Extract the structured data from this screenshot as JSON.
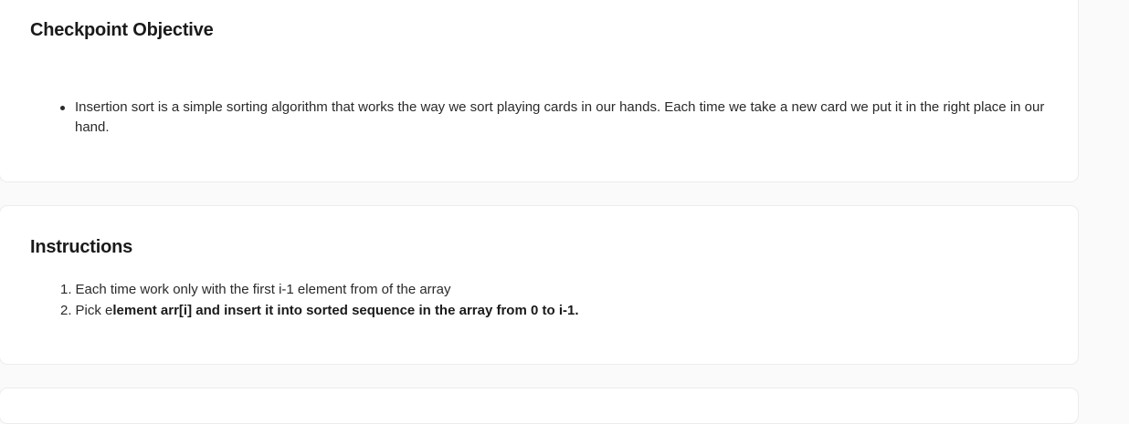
{
  "objective": {
    "title": "Checkpoint Objective",
    "bullets": [
      "Insertion sort is a simple sorting algorithm that works the way we sort playing cards in our hands. Each time we take a new card we put it in the right place in our hand."
    ]
  },
  "instructions": {
    "title": "Instructions",
    "steps": [
      {
        "number": "1.",
        "text": "Each time work only with the first i-1 element from of the array",
        "bold": ""
      },
      {
        "number": "2.",
        "text": "Pick e",
        "bold": "lement arr[i] and insert it into sorted sequence in the array from 0 to i-1."
      }
    ]
  }
}
